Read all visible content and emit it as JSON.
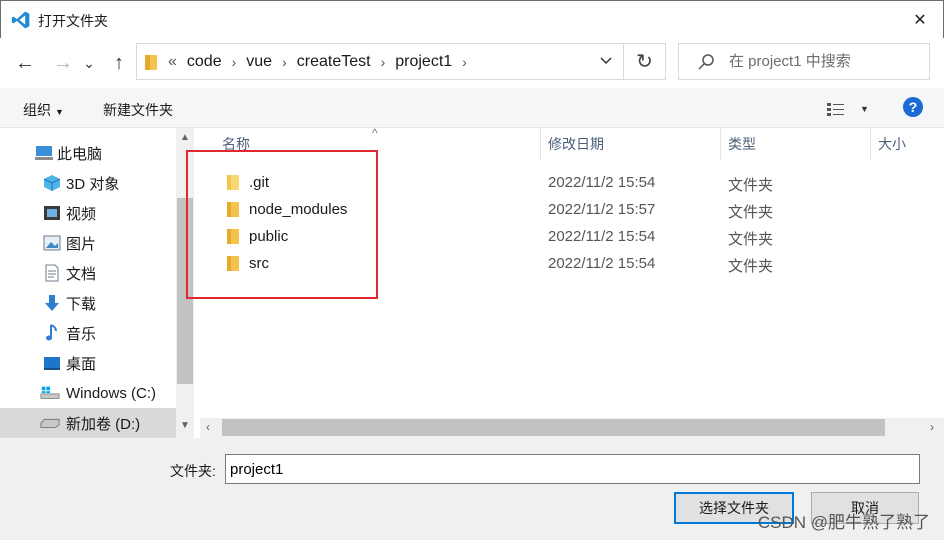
{
  "window": {
    "title": "打开文件夹",
    "close_symbol": "✕"
  },
  "nav": {
    "back_symbol": "←",
    "forward_symbol": "→",
    "recent_symbol": "⌄",
    "up_symbol": "↑",
    "address": {
      "overflow": "«",
      "crumbs": [
        "code",
        "vue",
        "createTest",
        "project1"
      ],
      "separator": "›"
    },
    "refresh_symbol": "↻",
    "search_placeholder": "在 project1 中搜索"
  },
  "toolbar": {
    "organize_label": "组织",
    "organize_caret": "▼",
    "new_folder_label": "新建文件夹",
    "view_caret": "▼",
    "help_label": "?"
  },
  "sidebar": {
    "items": [
      {
        "label": "此电脑",
        "icon": "computer-icon"
      },
      {
        "label": "3D 对象",
        "icon": "cube-3d-icon"
      },
      {
        "label": "视频",
        "icon": "video-icon"
      },
      {
        "label": "图片",
        "icon": "picture-icon"
      },
      {
        "label": "文档",
        "icon": "document-icon"
      },
      {
        "label": "下载",
        "icon": "download-icon"
      },
      {
        "label": "音乐",
        "icon": "music-icon"
      },
      {
        "label": "桌面",
        "icon": "desktop-icon"
      },
      {
        "label": "Windows (C:)",
        "icon": "drive-c-icon"
      },
      {
        "label": "新加卷 (D:)",
        "icon": "drive-d-icon",
        "selected": true
      }
    ],
    "scroll_up": "▲",
    "scroll_down": "▼"
  },
  "file_list": {
    "columns": [
      "名称",
      "修改日期",
      "类型",
      "大小"
    ],
    "sort_indicator": "^",
    "rows": [
      {
        "name": ".git",
        "modified": "2022/11/2 15:54",
        "type": "文件夹"
      },
      {
        "name": "node_modules",
        "modified": "2022/11/2 15:57",
        "type": "文件夹"
      },
      {
        "name": "public",
        "modified": "2022/11/2 15:54",
        "type": "文件夹"
      },
      {
        "name": "src",
        "modified": "2022/11/2 15:54",
        "type": "文件夹"
      }
    ],
    "hscroll_left": "‹",
    "hscroll_right": "›"
  },
  "footer": {
    "folder_label": "文件夹:",
    "folder_value": "project1",
    "select_button": "选择文件夹",
    "cancel_button": "取消",
    "watermark": "CSDN @肥牛熟了熟了"
  },
  "colors": {
    "highlight_box": "#e0282e",
    "folder_yellow": "#f5c34b",
    "accent_blue": "#0078d7"
  }
}
